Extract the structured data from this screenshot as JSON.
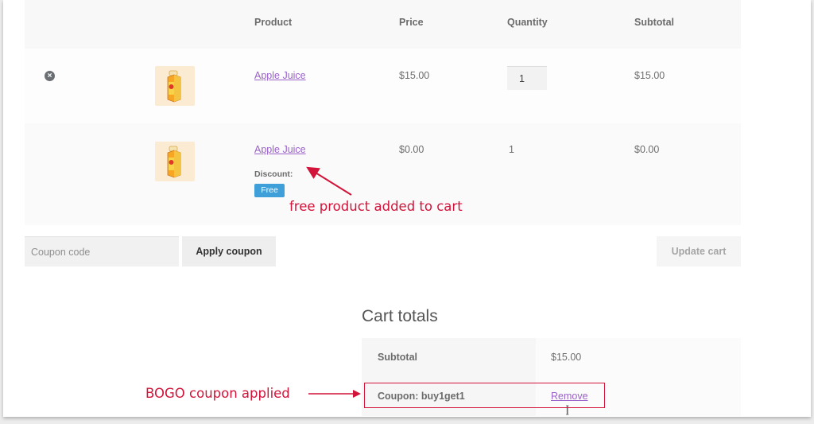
{
  "cart": {
    "headers": [
      "",
      "",
      "Product",
      "Price",
      "Quantity",
      "Subtotal"
    ],
    "items": [
      {
        "product": "Apple Juice",
        "price": "$15.00",
        "quantity": "1",
        "subtotal": "$15.00",
        "removable": true,
        "thumbnail": "apple-juice-bottle"
      },
      {
        "product": "Apple Juice",
        "price": "$0.00",
        "quantity": "1",
        "subtotal": "$0.00",
        "removable": false,
        "thumbnail": "apple-juice-bottle",
        "discount_label": "Discount:",
        "discount_badge": "Free"
      }
    ],
    "remove_icon": "close-circle-icon"
  },
  "actions": {
    "coupon_placeholder": "Coupon code",
    "coupon_value": "",
    "apply_coupon_label": "Apply coupon",
    "update_cart_label": "Update cart"
  },
  "totals": {
    "title": "Cart totals",
    "rows": [
      {
        "label": "Subtotal",
        "value": "$15.00"
      },
      {
        "label": "Coupon: buy1get1",
        "value_open": "[",
        "value_link": "Remove",
        "value_close": "]"
      }
    ]
  },
  "annotations": {
    "free_product": "free product added to cart",
    "bogo_coupon": "BOGO coupon applied",
    "color": "#d2143a"
  },
  "colors": {
    "link": "#9a62c9",
    "badge": "#3f9fd8"
  }
}
